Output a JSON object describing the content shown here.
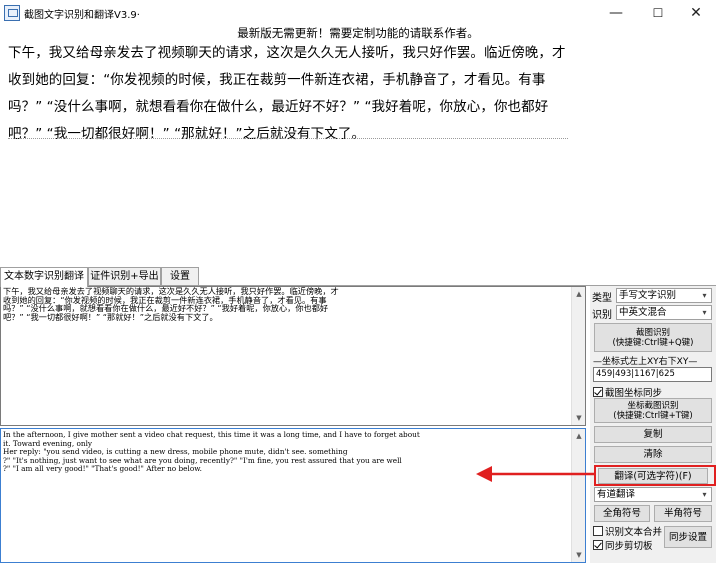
{
  "window": {
    "title": "截图文字识别和翻译V3.9·",
    "notice": "最新版无需更新！需要定制功能的请联系作者。",
    "minimize_glyph": "—",
    "maximize_glyph": "☐",
    "close_glyph": "✕"
  },
  "preview": {
    "lines": [
      "下午，我又给母亲发去了视频聊天的请求，这次是久久无人接听，我只好作罢。临近傍晚，才",
      "收到她的回复：“你发视频的时候，我正在裁剪一件新连衣裙，手机静音了，才看见。有事",
      "吗？” “没什么事啊，就想看看你在做什么，最近好不好？” “我好着呢，你放心，你也都好",
      "吧？” “我一切都很好啊！” “那就好！”之后就没有下文了。"
    ]
  },
  "tabs": [
    {
      "label": "文本数字识别翻译"
    },
    {
      "label": "证件识别+导出"
    },
    {
      "label": "设置"
    }
  ],
  "ocr_text": {
    "lines": [
      "下午，我又给母亲发去了视频聊天的请求，这次是久久无人接听，我只好作罢。临近傍晚，才",
      "收到她的回复：“你发视频的时候，我正在裁剪一件新连衣裙，手机静音了，才看见。有事",
      "吗？” “没什么事啊，就想看看你在做什么，最近好不好？” “我好着呢，你放心，你也都好",
      "吧？” “我一切都很好啊！” “那就好！”之后就没有下文了。"
    ]
  },
  "translation_text": {
    "lines": [
      "In the afternoon, I give mother sent a video chat request, this time it was a long time, and I have to forget about",
      "it. Toward evening, only",
      "Her reply: \"you send video, is cutting a new dress, mobile phone mute, didn't see. something",
      "?\" \"It's nothing, just want to see what are you doing, recently?\" \"I'm fine, you rest assured that you are well",
      "?\" \"I am all very good!\" \"That's good!\" After no below."
    ]
  },
  "side": {
    "type_label": "类型",
    "type_value": "手写文字识别",
    "recog_label": "识别",
    "recog_value": "中英文混合",
    "capture_button": {
      "line1": "截图识别",
      "line2": "(快捷键:Ctrl键+Q键)"
    },
    "coord_title": "—坐标式左上XY右下XY—",
    "coord_value": "459|493|1167|625",
    "sync_coord_label": "截图坐标同步",
    "coord_button": {
      "line1": "坐标截图识别",
      "line2": "(快捷键:Ctrl键+T键)"
    },
    "copy_label": "复制",
    "clear_label": "清除",
    "translate_label": "翻译(可选字符)(F)",
    "engine_value": "有道翻译",
    "fullwidth_label": "全角符号",
    "halfwidth_label": "半角符号",
    "merge_label": "识别文本合并",
    "sync_clip_label": "同步剪切板",
    "sync_settings_label": "同步设置"
  },
  "colors": {
    "highlight": "#e02020",
    "focus_border": "#3c7fd1",
    "panel_bg": "#f0f0f0"
  },
  "icons": {
    "dropdown": "▾",
    "scroll_up": "▲",
    "scroll_down": "▼"
  }
}
